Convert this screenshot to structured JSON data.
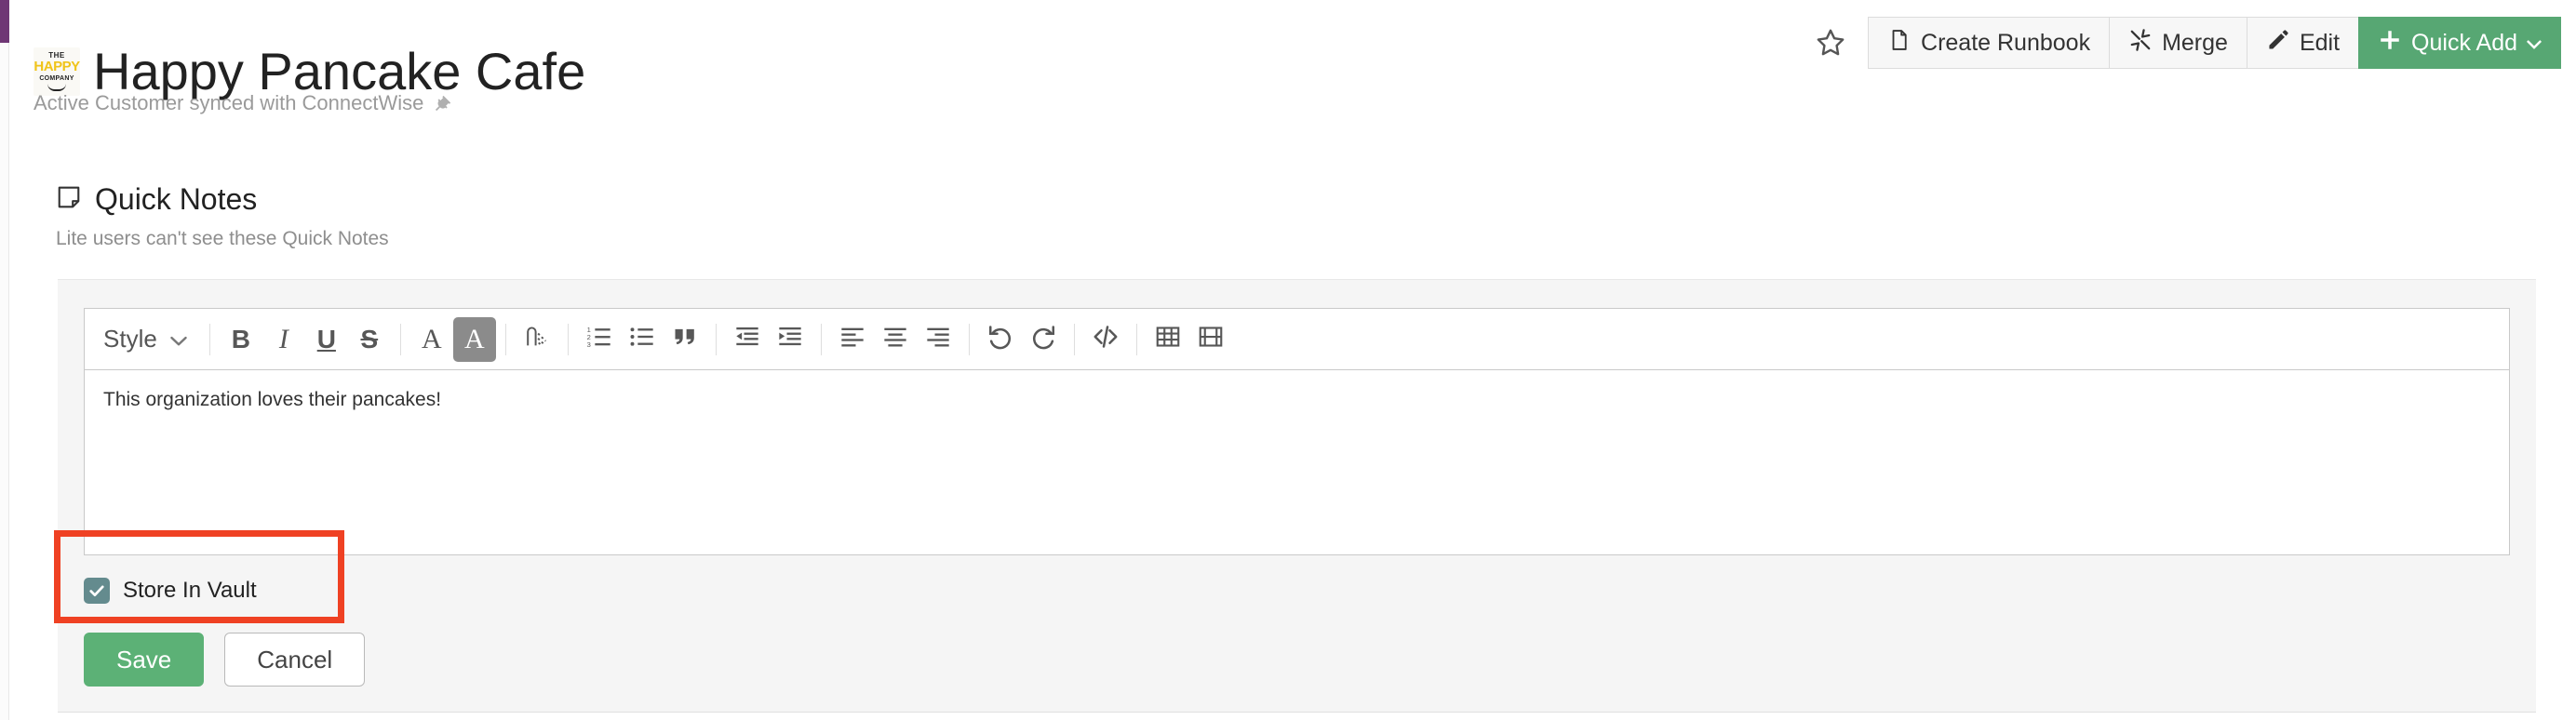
{
  "header": {
    "logo_line1": "THE",
    "logo_line2": "HAPPY",
    "logo_line3": "COMPANY",
    "title": "Happy Pancake Cafe",
    "subtitle": "Active Customer synced with ConnectWise",
    "plug_icon": "plug-icon",
    "favorite_icon": "star-icon",
    "actions": [
      {
        "label": "Create Runbook",
        "icon": "document-icon",
        "primary": false
      },
      {
        "label": "Merge",
        "icon": "merge-arrows-icon",
        "primary": false
      },
      {
        "label": "Edit",
        "icon": "pencil-icon",
        "primary": false
      },
      {
        "label": "Quick Add",
        "icon": "plus-icon",
        "caret": "chevron-down-icon",
        "primary": true
      }
    ]
  },
  "quick_notes": {
    "icon": "sticky-note-icon",
    "title": "Quick Notes",
    "subtitle": "Lite users can't see these Quick Notes"
  },
  "editor": {
    "style_label": "Style",
    "style_caret": "chevron-down-icon",
    "toolbar": [
      {
        "name": "bold",
        "glyph": "B",
        "kind": "text-b"
      },
      {
        "name": "italic",
        "glyph": "I",
        "kind": "text-i"
      },
      {
        "name": "underline",
        "glyph": "U",
        "kind": "text-u"
      },
      {
        "name": "strikethrough",
        "glyph": "S",
        "kind": "text-s"
      },
      {
        "name": "font-color",
        "glyph": "A",
        "kind": "text-a"
      },
      {
        "name": "highlight-color",
        "glyph": "A",
        "kind": "text-a",
        "active": true
      },
      {
        "name": "remove-format",
        "kind": "eraser"
      },
      {
        "name": "numbered-list",
        "kind": "ol"
      },
      {
        "name": "bulleted-list",
        "kind": "ul"
      },
      {
        "name": "blockquote",
        "kind": "quote"
      },
      {
        "name": "outdent",
        "kind": "outdent"
      },
      {
        "name": "indent",
        "kind": "indent"
      },
      {
        "name": "align-left",
        "kind": "align-left"
      },
      {
        "name": "align-center",
        "kind": "align-center"
      },
      {
        "name": "align-right",
        "kind": "align-right"
      },
      {
        "name": "undo",
        "kind": "undo"
      },
      {
        "name": "redo",
        "kind": "redo"
      },
      {
        "name": "source-code",
        "kind": "code"
      },
      {
        "name": "insert-table",
        "kind": "table"
      },
      {
        "name": "insert-video",
        "kind": "video"
      }
    ],
    "content": "This organization loves their pancakes!"
  },
  "vault": {
    "label": "Store In Vault",
    "checked": true,
    "check_icon": "checkmark-icon"
  },
  "footer": {
    "save_label": "Save",
    "cancel_label": "Cancel"
  },
  "colors": {
    "rail_purple": "#6f3675",
    "primary_green": "#57a773",
    "save_green": "#5cb176",
    "checkbox_teal": "#648b8e",
    "highlight_red": "#ef4123",
    "panel_gray": "#f5f5f5"
  }
}
